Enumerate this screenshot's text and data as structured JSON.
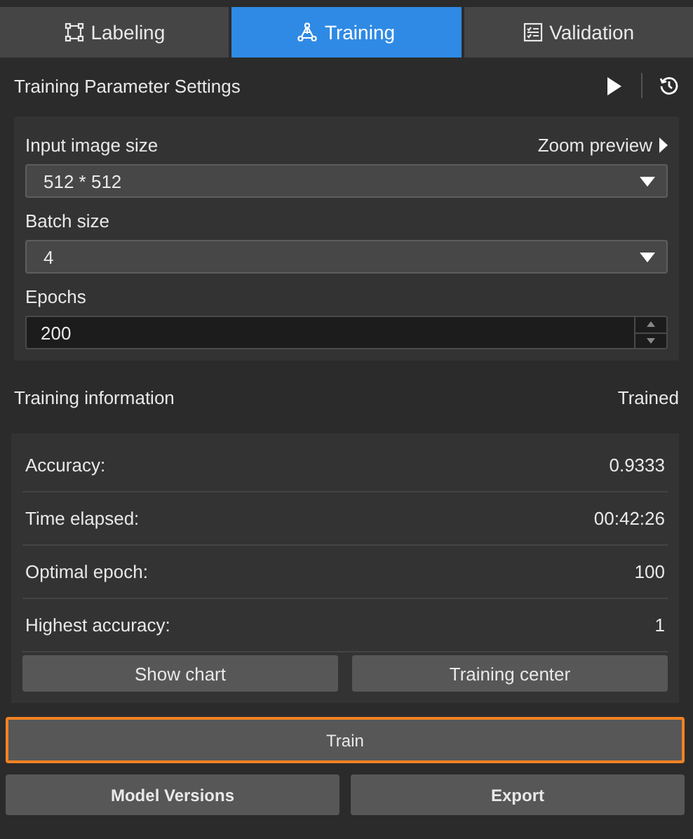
{
  "tabs": [
    {
      "label": "Labeling",
      "selected": false
    },
    {
      "label": "Training",
      "selected": true
    },
    {
      "label": "Validation",
      "selected": false
    }
  ],
  "settings": {
    "title": "Training Parameter Settings",
    "fields": [
      {
        "kind": "dropdown",
        "label": "Input image size",
        "link": "Zoom preview",
        "value": "512 * 512"
      },
      {
        "kind": "dropdown",
        "label": "Batch size",
        "value": "4"
      },
      {
        "kind": "spinbox",
        "label": "Epochs",
        "value": "200"
      }
    ]
  },
  "info": {
    "title": "Training information",
    "status": "Trained",
    "rows": [
      {
        "label": "Accuracy:",
        "value": "0.9333"
      },
      {
        "label": "Time elapsed:",
        "value": "00:42:26"
      },
      {
        "label": "Optimal epoch:",
        "value": "100"
      },
      {
        "label": "Highest accuracy:",
        "value": "1"
      }
    ],
    "buttons": [
      "Show chart",
      "Training center"
    ]
  },
  "train_button": {
    "label": "Train",
    "focused": true
  },
  "bottom_buttons": [
    "Model Versions",
    "Export"
  ]
}
